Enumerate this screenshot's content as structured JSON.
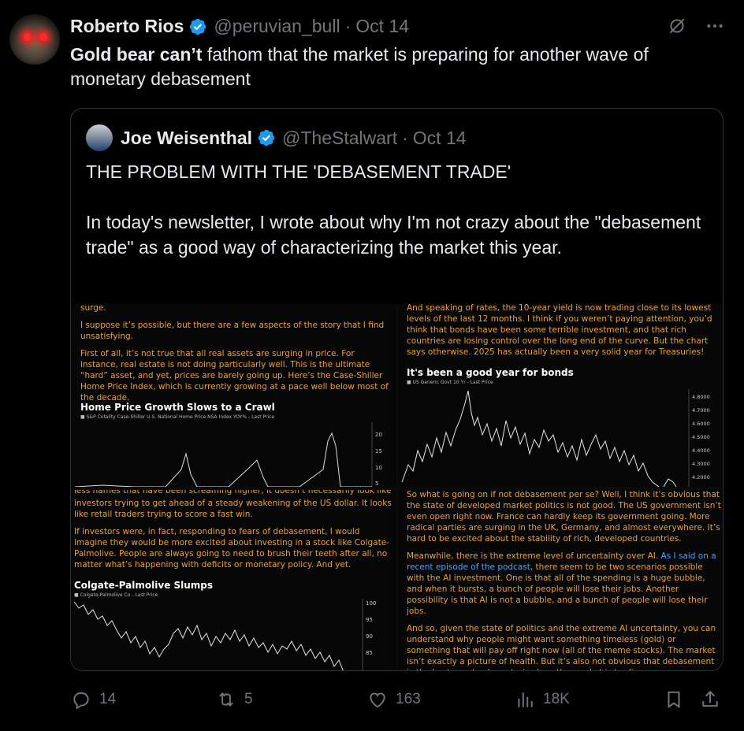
{
  "tweet": {
    "author_name": "Roberto Rios",
    "handle": "@peruvian_bull",
    "date": "Oct 14",
    "text_bold": "Gold bear can’t",
    "text_rest": " fathom that the market is preparing for another wave of monetary debasement"
  },
  "quote": {
    "author_name": "Joe Weisenthal",
    "handle": "@TheStalwart",
    "date": "Oct 14",
    "text": "THE PROBLEM WITH THE 'DEBASEMENT TRADE'\n\nIn today's newsletter, I wrote about why I'm not crazy about the \"debasement trade\" as a good way of characterizing the market this year."
  },
  "collage": {
    "top_left": {
      "cut_line": "surge.",
      "para1": "I suppose it’s possible, but there are a few aspects of the story that I find unsatisfying.",
      "para2": "First of all, it’s not true that all real assets are surging in price. For instance, real estate is not doing particularly well. This is the ultimate “hard” asset, and yet, prices are barely going up. Here’s the Case-Shiller Home Price Index, which is currently growing at a pace well below most of the decade.",
      "chart_title": "Home Price Growth Slows to a Crawl",
      "chart_legend": "■ S&P Cotality Case-Shiller U.S. National Home Price NSA Index YOY% - Last Price",
      "ticks": [
        "20",
        "15",
        "10",
        "5"
      ]
    },
    "top_right": {
      "para1": "And speaking of rates, the 10-year yield is now trading close to its lowest levels of the last 12 months. I think if you weren’t paying attention, you’d think that bonds have been some terrible investment, and that rich countries are losing control over the long end of the curve. But the chart says otherwise. 2025 has actually been a very solid year for Treasuries!",
      "chart_title": "It's been a good year for bonds",
      "chart_legend": "■ US Generic Govt 10 Yr - Last Price",
      "ticks": [
        "4.8000",
        "4.7000",
        "4.6000",
        "4.5000",
        "4.4000",
        "4.3000",
        "4.2000"
      ]
    },
    "bottom_left": {
      "cut_line": "less names that have been screaming higher, it doesn’t necessarily look like",
      "para1": "investors trying to get ahead of a steady weakening of the US dollar. It looks like retail traders trying to score a fast win.",
      "para2": "If investors were, in fact, responding to fears of debasement, I would imagine they would be more excited about investing in a stock like Colgate-Palmolive. People are always going to need to brush their teeth after all, no matter what’s happening with deficits or monetary policy. And yet.",
      "chart_title": "Colgate-Palmolive Slumps",
      "chart_legend": "■ Colgate-Palmolive Co - Last Price",
      "ticks": [
        "100",
        "95",
        "90",
        "85"
      ]
    },
    "bottom_right": {
      "para1": "So what is going on if not debasement per se? Well, I think it’s obvious that the state of developed market politics is not good. The US government isn’t even open right now. France can hardly keep its government going. More radical parties are surging in the UK, Germany, and almost everywhere. It’s hard to be excited about the stability of rich, developed countries.",
      "para2_start": "Meanwhile, there is the extreme level of uncertainty over AI. ",
      "para2_link": "As I said on a recent episode of the podcast",
      "para2_end": ", there seem to be two scenarios possible with the AI investment. One is that all of the spending is a huge bubble, and when it bursts, a bunch of people will lose their jobs. Another possibility is that AI is not a bubble, and a bunch of people will lose their jobs.",
      "para3": "And so, given the state of politics and the extreme AI uncertainty, you can understand why people might want something timeless (gold) or something that will pay off right now (all of the meme stocks). The market isn’t exactly a picture of health. But it’s also not obvious that debasement is the best way to characterize how the market is trading."
    }
  },
  "actions": {
    "replies": "14",
    "reposts": "5",
    "likes": "163",
    "views": "18K"
  },
  "colors": {
    "accent": "#1d9bf0",
    "newsletter_text": "#e9a23b",
    "muted": "#71767b"
  }
}
